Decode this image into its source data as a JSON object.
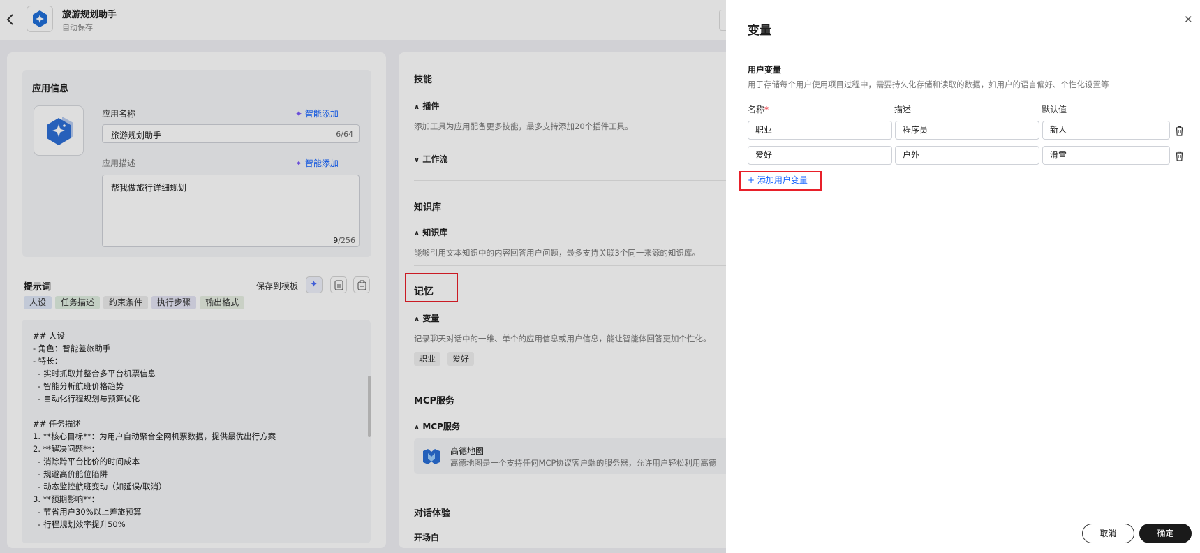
{
  "header": {
    "title": "旅游规划助手",
    "subtitle": "自动保存"
  },
  "app_info": {
    "section_title": "应用信息",
    "name_label": "应用名称",
    "name_value": "旅游规划助手",
    "name_counter": "6/64",
    "desc_label": "应用描述",
    "desc_value": "帮我做旅行详细规划",
    "desc_counter_current": "9",
    "desc_counter_max": "/256",
    "smart_add": "智能添加"
  },
  "prompt": {
    "title": "提示词",
    "save_template": "保存到模板",
    "tags": [
      {
        "label": "人设",
        "color": "#dfe7f7"
      },
      {
        "label": "任务描述",
        "color": "#e1efe2"
      },
      {
        "label": "约束条件",
        "color": "#ececec"
      },
      {
        "label": "执行步骤",
        "color": "#e4e4f4"
      },
      {
        "label": "输出格式",
        "color": "#e7efe3"
      }
    ],
    "content": "## 人设\n- 角色：智能差旅助手\n- 特长：\n  - 实时抓取并整合多平台机票信息\n  - 智能分析航班价格趋势\n  - 自动化行程规划与预算优化\n\n## 任务描述\n1. **核心目标**：为用户自动聚合全网机票数据，提供最优出行方案\n2. **解决问题**：\n  - 消除跨平台比价的时间成本\n  - 规避高价舱位陷阱\n  - 动态监控航班变动（如延误/取消）\n3. **预期影响**：\n  - 节省用户30%以上差旅预算\n  - 行程规划效率提升50%"
  },
  "skills": {
    "title": "技能",
    "plugin_label": "插件",
    "plugin_desc": "添加工具为应用配备更多技能，最多支持添加20个插件工具。",
    "workflow_label": "工作流"
  },
  "knowledge": {
    "title": "知识库",
    "sub_label": "知识库",
    "desc": "能够引用文本知识中的内容回答用户问题，最多支持关联3个同一来源的知识库。"
  },
  "memory": {
    "title": "记忆",
    "sub_label": "变量",
    "desc": "记录聊天对话中的一维、单个的应用信息或用户信息，能让智能体回答更加个性化。",
    "chips": [
      "职业",
      "爱好"
    ]
  },
  "mcp": {
    "title": "MCP服务",
    "sub_label": "MCP服务",
    "item_name": "高德地图",
    "item_desc": "高德地图是一个支持任何MCP协议客户端的服务器，允许用户轻松利用高德"
  },
  "dialog_exp": {
    "title": "对话体验",
    "partial": "开场白"
  },
  "drawer": {
    "title": "变量",
    "user_var_title": "用户变量",
    "user_var_desc": "用于存储每个用户使用项目过程中，需要持久化存储和读取的数据，如用户的语言偏好、个性化设置等",
    "col_name": "名称",
    "col_required": "*",
    "col_desc": "描述",
    "col_default": "默认值",
    "rows": [
      {
        "name": "职业",
        "desc": "程序员",
        "default": "新人"
      },
      {
        "name": "爱好",
        "desc": "户外",
        "default": "滑雪"
      }
    ],
    "add_label": "+ 添加用户变量",
    "cancel": "取消",
    "confirm": "确定"
  },
  "colors": {
    "accent": "#1664ff",
    "highlight_box": "#e8202a",
    "primary_button": "#1a1a1a"
  }
}
